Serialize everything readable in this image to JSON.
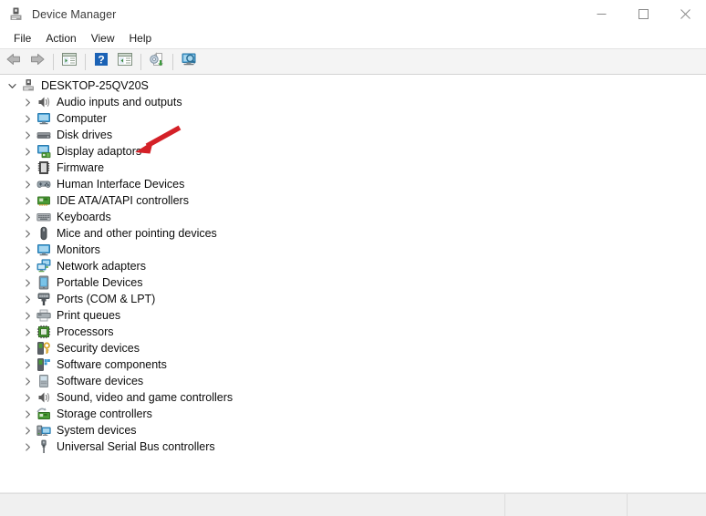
{
  "window": {
    "title": "Device Manager",
    "app_icon": "device-manager-icon",
    "controls": {
      "minimize": "minimize-icon",
      "maximize": "maximize-icon",
      "close": "close-icon"
    }
  },
  "menubar": {
    "items": [
      {
        "label": "File"
      },
      {
        "label": "Action"
      },
      {
        "label": "View"
      },
      {
        "label": "Help"
      }
    ]
  },
  "toolbar": {
    "buttons": [
      {
        "name": "back-button",
        "icon": "back-arrow-icon"
      },
      {
        "name": "forward-button",
        "icon": "forward-arrow-icon"
      },
      {
        "name": "show-hide-console-tree-button",
        "icon": "console-tree-icon"
      },
      {
        "name": "help-button",
        "icon": "question-mark-icon"
      },
      {
        "name": "properties-button",
        "icon": "properties-window-icon"
      },
      {
        "name": "update-driver-button",
        "icon": "update-driver-icon"
      },
      {
        "name": "scan-for-hardware-changes-button",
        "icon": "scan-hardware-icon"
      }
    ]
  },
  "tree": {
    "root": {
      "label": "DESKTOP-25QV20S",
      "icon": "computer-root-icon",
      "expanded": true
    },
    "items": [
      {
        "label": "Audio inputs and outputs",
        "icon": "speaker-icon"
      },
      {
        "label": "Computer",
        "icon": "monitor-icon"
      },
      {
        "label": "Disk drives",
        "icon": "disk-drive-icon"
      },
      {
        "label": "Display adaptors",
        "icon": "display-adapter-icon"
      },
      {
        "label": "Firmware",
        "icon": "firmware-chip-icon"
      },
      {
        "label": "Human Interface Devices",
        "icon": "gamepad-icon"
      },
      {
        "label": "IDE ATA/ATAPI controllers",
        "icon": "ide-controller-icon"
      },
      {
        "label": "Keyboards",
        "icon": "keyboard-icon"
      },
      {
        "label": "Mice and other pointing devices",
        "icon": "mouse-icon"
      },
      {
        "label": "Monitors",
        "icon": "monitor-icon"
      },
      {
        "label": "Network adapters",
        "icon": "network-adapter-icon"
      },
      {
        "label": "Portable Devices",
        "icon": "portable-device-icon"
      },
      {
        "label": "Ports (COM & LPT)",
        "icon": "port-connector-icon"
      },
      {
        "label": "Print queues",
        "icon": "printer-icon"
      },
      {
        "label": "Processors",
        "icon": "processor-chip-icon"
      },
      {
        "label": "Security devices",
        "icon": "security-key-icon"
      },
      {
        "label": "Software components",
        "icon": "software-component-icon"
      },
      {
        "label": "Software devices",
        "icon": "software-device-icon"
      },
      {
        "label": "Sound, video and game controllers",
        "icon": "speaker-icon"
      },
      {
        "label": "Storage controllers",
        "icon": "storage-controller-icon"
      },
      {
        "label": "System devices",
        "icon": "system-device-icon"
      },
      {
        "label": "Universal Serial Bus controllers",
        "icon": "usb-icon"
      }
    ]
  },
  "annotation": {
    "name": "red-arrow-annotation",
    "color": "#d42027",
    "points_to": "Display adaptors"
  },
  "statusbar": {
    "panes": [
      "",
      "",
      ""
    ]
  },
  "colors": {
    "accent_blue": "#3a9fd8",
    "icon_green": "#4a9b36",
    "annotation_red": "#d42027",
    "toolbar_bg": "#f4f4f4",
    "statusbar_bg": "#f0f0f0"
  }
}
